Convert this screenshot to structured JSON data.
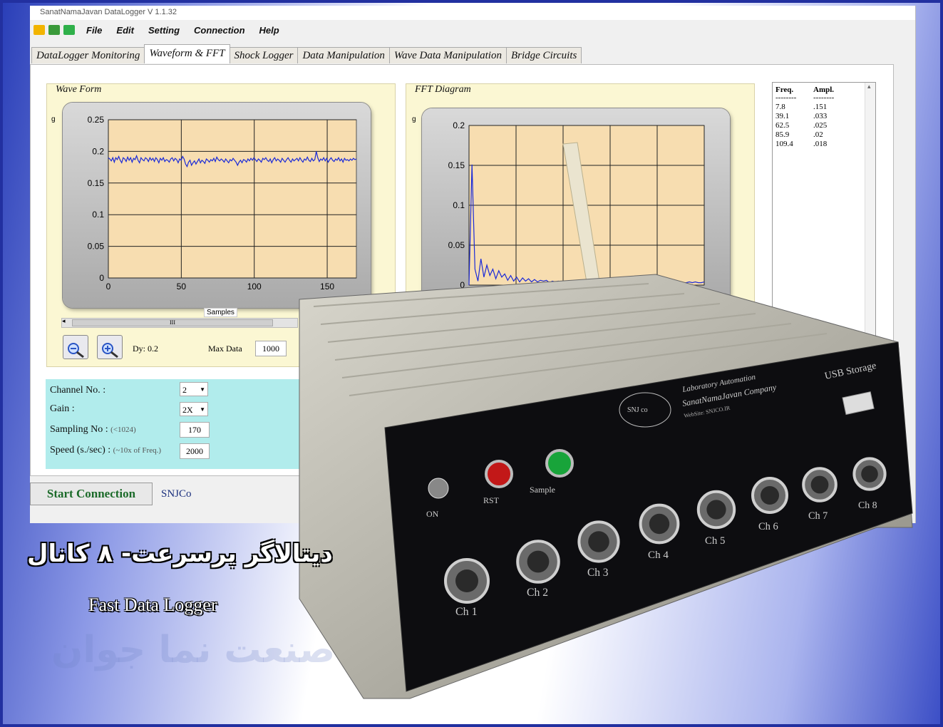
{
  "app": {
    "title": "SanatNamaJavan DataLogger V 1.1.32",
    "menu": [
      "File",
      "Edit",
      "Setting",
      "Connection",
      "Help"
    ],
    "tabs": [
      "DataLogger Monitoring",
      "Waveform & FFT",
      "Shock Logger",
      "Data Manipulation",
      "Wave Data Manipulation",
      "Bridge Circuits"
    ],
    "active_tab": "Waveform & FFT"
  },
  "waveform_panel": {
    "title": "Wave Form",
    "unit": "g",
    "xlabel": "Samples",
    "scroll_marker": "III",
    "dy_label": "Dy: 0.2",
    "max_data_label": "Max Data",
    "max_data_value": "1000"
  },
  "fft_panel": {
    "title": "FFT Diagram",
    "unit": "g"
  },
  "fft_table": {
    "col_freq": "Freq.",
    "col_ampl": "Ampl.",
    "sep": "--------",
    "rows": [
      [
        "7.8",
        ".151"
      ],
      [
        "39.1",
        ".033"
      ],
      [
        "62.5",
        ".025"
      ],
      [
        "85.9",
        ".02"
      ],
      [
        "109.4",
        ".018"
      ]
    ]
  },
  "settings": {
    "channel_label": "Channel No. :",
    "channel_value": "2",
    "gain_label": "Gain :",
    "gain_value": "2X",
    "sampling_label": "Sampling No :",
    "sampling_hint": "(<1024)",
    "sampling_value": "170",
    "speed_label": "Speed (s./sec) :",
    "speed_hint": "(~10x of Freq.)",
    "speed_value": "2000"
  },
  "start_button": "Start Connection",
  "company": "SNJCo",
  "device": {
    "brand": "SNJ co",
    "line1": "Laboratory Automation",
    "line2": "SanatNamaJavan Company",
    "website": "WebSite: SNJCO.IR",
    "usb_label": "USB Storage",
    "switch_labels": [
      "ON",
      "RST",
      "Sample"
    ],
    "channels": [
      "Ch 1",
      "Ch 2",
      "Ch 3",
      "Ch 4",
      "Ch 5",
      "Ch 6",
      "Ch 7",
      "Ch 8"
    ]
  },
  "caption_fa": "دیتالاگر پرسرعت- ۸ کانال",
  "caption_en": "Fast Data Logger",
  "watermark": "صنعت نما جوان",
  "chart_data": [
    {
      "type": "line",
      "title": "Wave Form",
      "xlabel": "Samples",
      "ylabel": "g",
      "xlim": [
        0,
        170
      ],
      "ylim": [
        0,
        0.25
      ],
      "xticks": [
        0,
        50,
        100,
        150
      ],
      "yticks": [
        0,
        0.05,
        0.1,
        0.15,
        0.2,
        0.25
      ],
      "ytick_labels": [
        "0",
        "0.05",
        "0.1",
        "0.15",
        "0.2",
        "0.25"
      ],
      "grid": true,
      "series": [
        {
          "values_description_free": true,
          "values": [
            0.19,
            0.188,
            0.185,
            0.19,
            0.183,
            0.19,
            0.187,
            0.192,
            0.186,
            0.182,
            0.19,
            0.188,
            0.184,
            0.191,
            0.186,
            0.19,
            0.183,
            0.189,
            0.187,
            0.193,
            0.186,
            0.182,
            0.19,
            0.187,
            0.185,
            0.19,
            0.188,
            0.184,
            0.19,
            0.186,
            0.189,
            0.184,
            0.19,
            0.187,
            0.182,
            0.189,
            0.186,
            0.19,
            0.184,
            0.187,
            0.186,
            0.183,
            0.188,
            0.19,
            0.185,
            0.189,
            0.187,
            0.182,
            0.188,
            0.186,
            0.192,
            0.188,
            0.18,
            0.176,
            0.183,
            0.186,
            0.178,
            0.182,
            0.185,
            0.18,
            0.184,
            0.188,
            0.182,
            0.186,
            0.184,
            0.181,
            0.188,
            0.186,
            0.183,
            0.187,
            0.185,
            0.189,
            0.184,
            0.191,
            0.187,
            0.185,
            0.188,
            0.186,
            0.183,
            0.188,
            0.185,
            0.182,
            0.187,
            0.185,
            0.189,
            0.186,
            0.183,
            0.178,
            0.183,
            0.186,
            0.182,
            0.187,
            0.186,
            0.183,
            0.188,
            0.185,
            0.189,
            0.186,
            0.19,
            0.187,
            0.184,
            0.188,
            0.186,
            0.183,
            0.189,
            0.187,
            0.19,
            0.186,
            0.184,
            0.188,
            0.182,
            0.187,
            0.19,
            0.185,
            0.188,
            0.186,
            0.183,
            0.189,
            0.186,
            0.183,
            0.187,
            0.19,
            0.186,
            0.183,
            0.188,
            0.185,
            0.187,
            0.189,
            0.185,
            0.19,
            0.186,
            0.183,
            0.188,
            0.186,
            0.191,
            0.186,
            0.184,
            0.189,
            0.185,
            0.187,
            0.2,
            0.19,
            0.184,
            0.188,
            0.186,
            0.19,
            0.185,
            0.189,
            0.183,
            0.187,
            0.19,
            0.186,
            0.184,
            0.188,
            0.186,
            0.19,
            0.185,
            0.188,
            0.183,
            0.189,
            0.186,
            0.187,
            0.185,
            0.188,
            0.186,
            0.189,
            0.187,
            0.188
          ]
        }
      ]
    },
    {
      "type": "line",
      "title": "FFT Diagram",
      "ylabel": "g",
      "xlim": [
        0,
        1000
      ],
      "ylim": [
        0,
        0.2
      ],
      "yticks": [
        0,
        0.05,
        0.1,
        0.15,
        0.2
      ],
      "ytick_labels": [
        "0",
        "0.05",
        "0.1",
        "0.15",
        "0.2"
      ],
      "grid": true,
      "series": [
        {
          "values": [
            0.0,
            0.151,
            0.02,
            0.005,
            0.033,
            0.01,
            0.025,
            0.012,
            0.02,
            0.008,
            0.018,
            0.01,
            0.014,
            0.006,
            0.012,
            0.005,
            0.01,
            0.004,
            0.009,
            0.005,
            0.008,
            0.004,
            0.007,
            0.004,
            0.006,
            0.005,
            0.006,
            0.003,
            0.005,
            0.004,
            0.005,
            0.003,
            0.005,
            0.004,
            0.004,
            0.003,
            0.004,
            0.004,
            0.003,
            0.004,
            0.004,
            0.003,
            0.004,
            0.003,
            0.004,
            0.003,
            0.003,
            0.004,
            0.003,
            0.004,
            0.003,
            0.003,
            0.004,
            0.003,
            0.003,
            0.004,
            0.003,
            0.003,
            0.003,
            0.004,
            0.003,
            0.003,
            0.004,
            0.003,
            0.003,
            0.003,
            0.004,
            0.003,
            0.003,
            0.003,
            0.004,
            0.003,
            0.003,
            0.003,
            0.004,
            0.003,
            0.004,
            0.003,
            0.003,
            0.004
          ]
        }
      ]
    }
  ]
}
